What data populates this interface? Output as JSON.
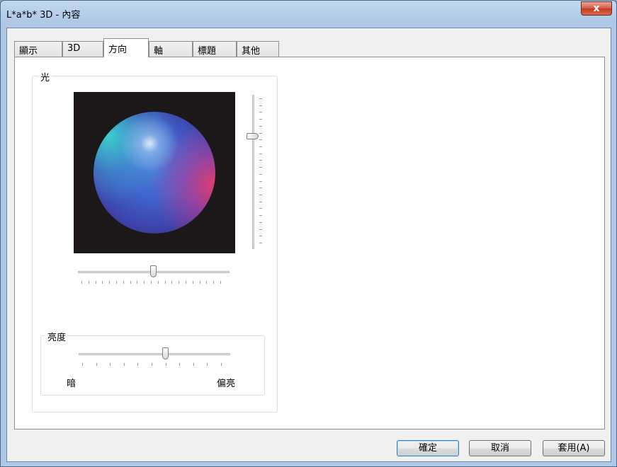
{
  "window": {
    "title": "L*a*b* 3D - 內容",
    "close_glyph": "x"
  },
  "tabs": [
    {
      "label": "顯示",
      "active": false
    },
    {
      "label": "3D",
      "active": false
    },
    {
      "label": "方向",
      "active": true
    },
    {
      "label": "軸",
      "active": false
    },
    {
      "label": "標題",
      "active": false
    },
    {
      "label": "其他",
      "active": false
    }
  ],
  "light_group": {
    "label": "光",
    "vertical_slider": {
      "value_fraction": 0.26,
      "tick_count": 22
    },
    "horizontal_slider": {
      "value_fraction": 0.52,
      "tick_count": 21
    }
  },
  "brightness_group": {
    "label": "亮度",
    "slider": {
      "value_fraction": 0.6,
      "tick_count": 11
    },
    "min_label": "暗",
    "max_label": "偏亮"
  },
  "buttons": {
    "ok": "確定",
    "cancel": "取消",
    "apply": "套用(A)"
  },
  "colors": {
    "sphere_background": "#1c1819",
    "sphere_base": "#3e63cc",
    "highlight_magenta": "#eb3c6e",
    "highlight_cyan": "#3cdcd2"
  }
}
